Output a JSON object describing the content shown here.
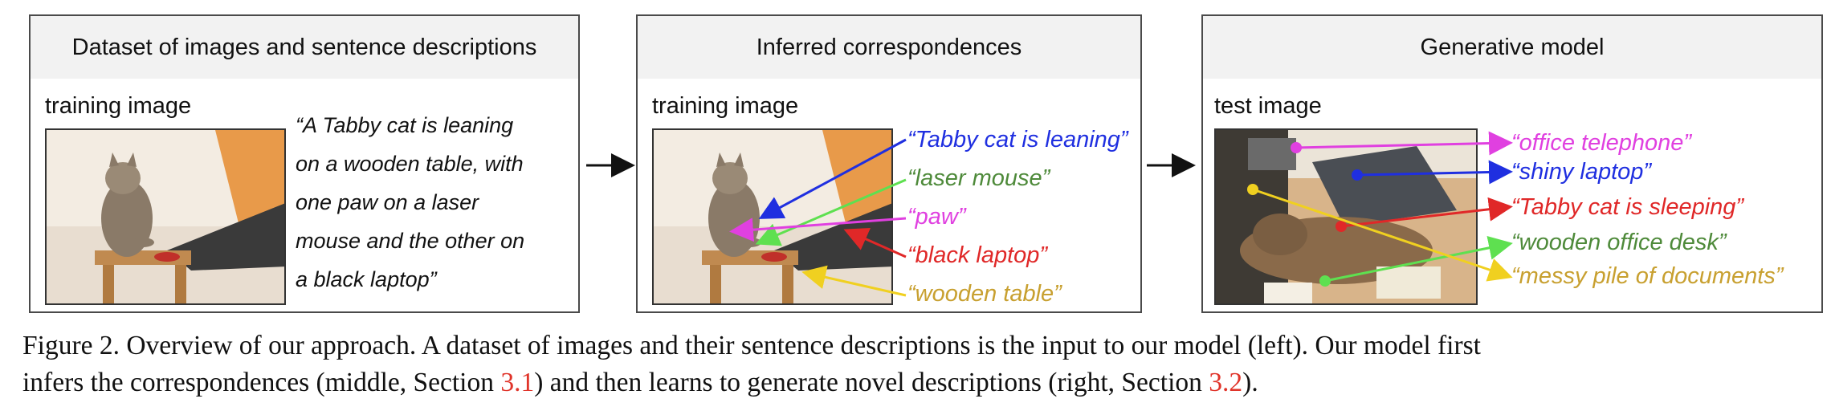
{
  "panels": {
    "dataset": {
      "title": "Dataset of images and sentence descriptions",
      "image_label": "training image",
      "quote_lines": [
        "“A Tabby cat is leaning",
        "on a wooden table, with",
        "one paw on a laser",
        "mouse and the other on",
        "a black laptop”"
      ]
    },
    "inferred": {
      "title": "Inferred correspondences",
      "image_label": "training image",
      "phrases": [
        {
          "text": "“Tabby cat is leaning”",
          "color": "#1f2fe0"
        },
        {
          "text": "“laser mouse”",
          "color": "#4e8a3a"
        },
        {
          "text": "“paw”",
          "color": "#e040e0"
        },
        {
          "text": "“black laptop”",
          "color": "#e02828"
        },
        {
          "text": "“wooden table”",
          "color": "#c8a030"
        }
      ]
    },
    "generative": {
      "title": "Generative model",
      "image_label": "test image",
      "phrases": [
        {
          "text": "“office telephone”",
          "color": "#e040e0"
        },
        {
          "text": "“shiny laptop”",
          "color": "#1f2fe0"
        },
        {
          "text": "“Tabby cat is sleeping”",
          "color": "#e02828"
        },
        {
          "text": "“wooden office desk”",
          "color": "#4e8a3a"
        },
        {
          "text": "“messy pile of documents”",
          "color": "#c8a030"
        }
      ]
    }
  },
  "caption": {
    "part1": "Figure 2. Overview of our approach. A dataset of images and their sentence descriptions is the input to our model (left). Our model first",
    "part2": "infers the correspondences (middle, Section ",
    "ref1": "3.1",
    "part3": ") and then learns to generate novel descriptions (right, Section ",
    "ref2": "3.2",
    "part4": ")."
  }
}
